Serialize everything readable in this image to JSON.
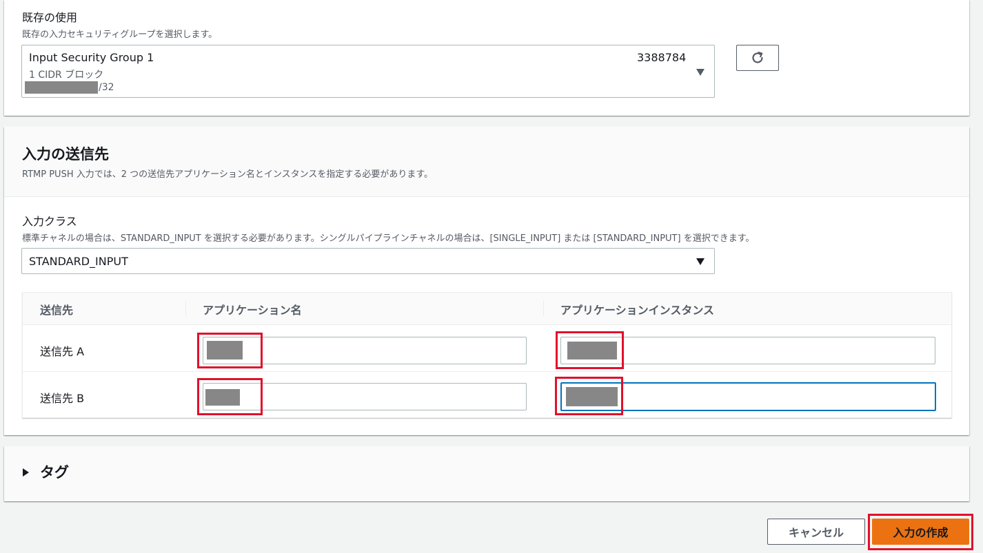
{
  "existing": {
    "label": "既存の使用",
    "description": "既存の入力セキュリティグループを選択します。",
    "selected": {
      "name": "Input Security Group 1",
      "id": "3388784",
      "cidr_count": "1 CIDR ブロック",
      "cidr_suffix": "/32"
    },
    "refresh_icon": "refresh-icon"
  },
  "destinations": {
    "title": "入力の送信先",
    "description": "RTMP PUSH 入力では、2 つの送信先アプリケーション名とインスタンスを指定する必要があります。",
    "input_class": {
      "label": "入力クラス",
      "description": "標準チャネルの場合は、STANDARD_INPUT を選択する必要があります。シングルパイプラインチャネルの場合は、[SINGLE_INPUT] または [STANDARD_INPUT] を選択できます。",
      "value": "STANDARD_INPUT"
    },
    "table": {
      "columns": [
        "送信先",
        "アプリケーション名",
        "アプリケーションインスタンス"
      ],
      "rows": [
        {
          "label": "送信先 A"
        },
        {
          "label": "送信先 B"
        }
      ]
    }
  },
  "tags": {
    "title": "タグ"
  },
  "footer": {
    "cancel_label": "キャンセル",
    "create_label": "入力の作成"
  },
  "colors": {
    "primary_button": "#ec7211",
    "highlight": "#e0102b",
    "focus": "#0073bb"
  }
}
